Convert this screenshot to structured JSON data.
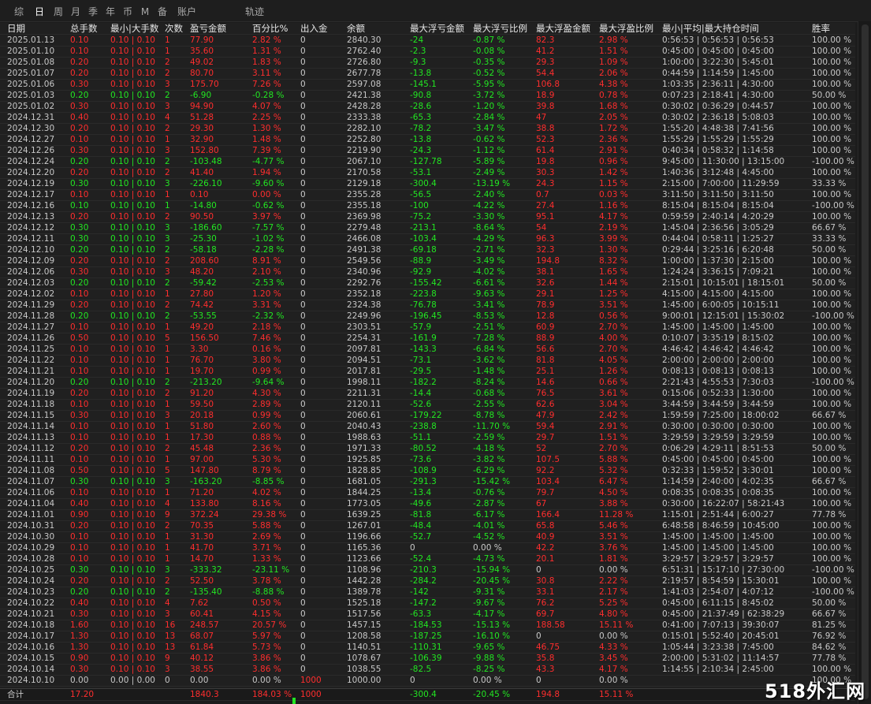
{
  "tabs": [
    "综",
    "日",
    "周",
    "月",
    "季",
    "年",
    "币",
    "M",
    "备",
    "账户",
    "轨迹"
  ],
  "active_tab": 1,
  "headers": [
    "日期",
    "总手数",
    "最小|大手数",
    "次数",
    "盈亏金额",
    "百分比%",
    "出入金",
    "余额",
    "最大浮亏金额",
    "最大浮亏比例",
    "最大浮盈金额",
    "最大浮盈比例",
    "最小|平均|最大持仓时间",
    "胜率"
  ],
  "rows": [
    [
      "2025.01.13",
      "0.10",
      "0.10 | 0.10",
      "1",
      "77.90",
      "2.82 %",
      "0",
      "2840.30",
      "-24",
      "-0.87 %",
      "82.3",
      "2.98 %",
      "0:56:53 | 0:56:53 | 0:56:53",
      "100.00 %"
    ],
    [
      "2025.01.10",
      "0.10",
      "0.10 | 0.10",
      "1",
      "35.60",
      "1.31 %",
      "0",
      "2762.40",
      "-2.3",
      "-0.08 %",
      "41.2",
      "1.51 %",
      "0:45:00 | 0:45:00 | 0:45:00",
      "100.00 %"
    ],
    [
      "2025.01.08",
      "0.20",
      "0.10 | 0.10",
      "2",
      "49.02",
      "1.83 %",
      "0",
      "2726.80",
      "-9.3",
      "-0.35 %",
      "29.3",
      "1.09 %",
      "1:00:00 | 3:22:30 | 5:45:01",
      "100.00 %"
    ],
    [
      "2025.01.07",
      "0.20",
      "0.10 | 0.10",
      "2",
      "80.70",
      "3.11 %",
      "0",
      "2677.78",
      "-13.8",
      "-0.52 %",
      "54.4",
      "2.06 %",
      "0:44:59 | 1:14:59 | 1:45:00",
      "100.00 %"
    ],
    [
      "2025.01.06",
      "0.30",
      "0.10 | 0.10",
      "3",
      "175.70",
      "7.26 %",
      "0",
      "2597.08",
      "-145.1",
      "-5.95 %",
      "106.8",
      "4.38 %",
      "1:03:35 | 2:36:11 | 4:30:00",
      "100.00 %"
    ],
    [
      "2025.01.03",
      "0.20",
      "0.10 | 0.10",
      "2",
      "-6.90",
      "-0.28 %",
      "0",
      "2421.38",
      "-90.8",
      "-3.72 %",
      "18.9",
      "0.78 %",
      "0:07:23 | 2:18:41 | 4:30:00",
      "50.00 %"
    ],
    [
      "2025.01.02",
      "0.30",
      "0.10 | 0.10",
      "3",
      "94.90",
      "4.07 %",
      "0",
      "2428.28",
      "-28.6",
      "-1.20 %",
      "39.8",
      "1.68 %",
      "0:30:02 | 0:36:29 | 0:44:57",
      "100.00 %"
    ],
    [
      "2024.12.31",
      "0.40",
      "0.10 | 0.10",
      "4",
      "51.28",
      "2.25 %",
      "0",
      "2333.38",
      "-65.3",
      "-2.84 %",
      "47",
      "2.05 %",
      "0:30:02 | 2:36:18 | 5:08:03",
      "100.00 %"
    ],
    [
      "2024.12.30",
      "0.20",
      "0.10 | 0.10",
      "2",
      "29.30",
      "1.30 %",
      "0",
      "2282.10",
      "-78.2",
      "-3.47 %",
      "38.8",
      "1.72 %",
      "1:55:20 | 4:48:38 | 7:41:56",
      "100.00 %"
    ],
    [
      "2024.12.27",
      "0.10",
      "0.10 | 0.10",
      "1",
      "32.90",
      "1.48 %",
      "0",
      "2252.80",
      "-13.8",
      "-0.62 %",
      "52.3",
      "2.36 %",
      "1:55:29 | 1:55:29 | 1:55:29",
      "100.00 %"
    ],
    [
      "2024.12.26",
      "0.30",
      "0.10 | 0.10",
      "3",
      "152.80",
      "7.39 %",
      "0",
      "2219.90",
      "-24.3",
      "-1.12 %",
      "61.4",
      "2.91 %",
      "0:40:34 | 0:58:32 | 1:14:58",
      "100.00 %"
    ],
    [
      "2024.12.24",
      "0.20",
      "0.10 | 0.10",
      "2",
      "-103.48",
      "-4.77 %",
      "0",
      "2067.10",
      "-127.78",
      "-5.89 %",
      "19.8",
      "0.96 %",
      "9:45:00 | 11:30:00 | 13:15:00",
      "-100.00 %"
    ],
    [
      "2024.12.20",
      "0.20",
      "0.10 | 0.10",
      "2",
      "41.40",
      "1.94 %",
      "0",
      "2170.58",
      "-53.1",
      "-2.49 %",
      "30.3",
      "1.42 %",
      "1:40:36 | 3:12:48 | 4:45:00",
      "100.00 %"
    ],
    [
      "2024.12.19",
      "0.30",
      "0.10 | 0.10",
      "3",
      "-226.10",
      "-9.60 %",
      "0",
      "2129.18",
      "-300.4",
      "-13.19 %",
      "24.3",
      "1.15 %",
      "2:15:00 | 7:00:00 | 11:29:59",
      "33.33 %"
    ],
    [
      "2024.12.17",
      "0.10",
      "0.10 | 0.10",
      "1",
      "0.10",
      "0.00 %",
      "0",
      "2355.28",
      "-56.5",
      "-2.40 %",
      "0.7",
      "0.03 %",
      "3:11:50 | 3:11:50 | 3:11:50",
      "100.00 %"
    ],
    [
      "2024.12.16",
      "0.10",
      "0.10 | 0.10",
      "1",
      "-14.80",
      "-0.62 %",
      "0",
      "2355.18",
      "-100",
      "-4.22 %",
      "27.4",
      "1.16 %",
      "8:15:04 | 8:15:04 | 8:15:04",
      "-100.00 %"
    ],
    [
      "2024.12.13",
      "0.20",
      "0.10 | 0.10",
      "2",
      "90.50",
      "3.97 %",
      "0",
      "2369.98",
      "-75.2",
      "-3.30 %",
      "95.1",
      "4.17 %",
      "0:59:59 | 2:40:14 | 4:20:29",
      "100.00 %"
    ],
    [
      "2024.12.12",
      "0.30",
      "0.10 | 0.10",
      "3",
      "-186.60",
      "-7.57 %",
      "0",
      "2279.48",
      "-213.1",
      "-8.64 %",
      "54",
      "2.19 %",
      "1:45:04 | 2:36:56 | 3:05:29",
      "66.67 %"
    ],
    [
      "2024.12.11",
      "0.30",
      "0.10 | 0.10",
      "3",
      "-25.30",
      "-1.02 %",
      "0",
      "2466.08",
      "-103.4",
      "-4.29 %",
      "96.3",
      "3.99 %",
      "0:44:04 | 0:58:11 | 1:25:27",
      "33.33 %"
    ],
    [
      "2024.12.10",
      "0.20",
      "0.10 | 0.10",
      "2",
      "-58.18",
      "-2.28 %",
      "0",
      "2491.38",
      "-69.18",
      "-2.71 %",
      "32.3",
      "1.30 %",
      "0:29:44 | 3:25:16 | 6:20:48",
      "50.00 %"
    ],
    [
      "2024.12.09",
      "0.20",
      "0.10 | 0.10",
      "2",
      "208.60",
      "8.91 %",
      "0",
      "2549.56",
      "-88.9",
      "-3.49 %",
      "194.8",
      "8.32 %",
      "1:00:00 | 1:37:30 | 2:15:00",
      "100.00 %"
    ],
    [
      "2024.12.06",
      "0.30",
      "0.10 | 0.10",
      "3",
      "48.20",
      "2.10 %",
      "0",
      "2340.96",
      "-92.9",
      "-4.02 %",
      "38.1",
      "1.65 %",
      "1:24:24 | 3:36:15 | 7:09:21",
      "100.00 %"
    ],
    [
      "2024.12.03",
      "0.20",
      "0.10 | 0.10",
      "2",
      "-59.42",
      "-2.53 %",
      "0",
      "2292.76",
      "-155.42",
      "-6.61 %",
      "32.6",
      "1.44 %",
      "2:15:01 | 10:15:01 | 18:15:01",
      "50.00 %"
    ],
    [
      "2024.12.02",
      "0.10",
      "0.10 | 0.10",
      "1",
      "27.80",
      "1.20 %",
      "0",
      "2352.18",
      "-223.8",
      "-9.63 %",
      "29.1",
      "1.25 %",
      "4:15:00 | 4:15:00 | 4:15:00",
      "100.00 %"
    ],
    [
      "2024.11.29",
      "0.20",
      "0.10 | 0.10",
      "2",
      "74.42",
      "3.31 %",
      "0",
      "2324.38",
      "-76.78",
      "-3.41 %",
      "78.9",
      "3.51 %",
      "1:45:00 | 6:00:05 | 10:15:11",
      "100.00 %"
    ],
    [
      "2024.11.28",
      "0.20",
      "0.10 | 0.10",
      "2",
      "-53.55",
      "-2.32 %",
      "0",
      "2249.96",
      "-196.45",
      "-8.53 %",
      "12.8",
      "0.56 %",
      "9:00:01 | 12:15:01 | 15:30:02",
      "-100.00 %"
    ],
    [
      "2024.11.27",
      "0.10",
      "0.10 | 0.10",
      "1",
      "49.20",
      "2.18 %",
      "0",
      "2303.51",
      "-57.9",
      "-2.51 %",
      "60.9",
      "2.70 %",
      "1:45:00 | 1:45:00 | 1:45:00",
      "100.00 %"
    ],
    [
      "2024.11.26",
      "0.50",
      "0.10 | 0.10",
      "5",
      "156.50",
      "7.46 %",
      "0",
      "2254.31",
      "-161.9",
      "-7.28 %",
      "88.9",
      "4.00 %",
      "0:10:07 | 3:35:19 | 8:15:02",
      "100.00 %"
    ],
    [
      "2024.11.25",
      "0.10",
      "0.10 | 0.10",
      "1",
      "3.30",
      "0.16 %",
      "0",
      "2097.81",
      "-143.3",
      "-6.84 %",
      "56.6",
      "2.70 %",
      "4:46:42 | 4:46:42 | 4:46:42",
      "100.00 %"
    ],
    [
      "2024.11.22",
      "0.10",
      "0.10 | 0.10",
      "1",
      "76.70",
      "3.80 %",
      "0",
      "2094.51",
      "-73.1",
      "-3.62 %",
      "81.8",
      "4.05 %",
      "2:00:00 | 2:00:00 | 2:00:00",
      "100.00 %"
    ],
    [
      "2024.11.21",
      "0.10",
      "0.10 | 0.10",
      "1",
      "19.70",
      "0.99 %",
      "0",
      "2017.81",
      "-29.5",
      "-1.48 %",
      "25.1",
      "1.26 %",
      "0:08:13 | 0:08:13 | 0:08:13",
      "100.00 %"
    ],
    [
      "2024.11.20",
      "0.20",
      "0.10 | 0.10",
      "2",
      "-213.20",
      "-9.64 %",
      "0",
      "1998.11",
      "-182.2",
      "-8.24 %",
      "14.6",
      "0.66 %",
      "2:21:43 | 4:55:53 | 7:30:03",
      "-100.00 %"
    ],
    [
      "2024.11.19",
      "0.20",
      "0.10 | 0.10",
      "2",
      "91.20",
      "4.30 %",
      "0",
      "2211.31",
      "-14.4",
      "-0.68 %",
      "76.5",
      "3.61 %",
      "0:15:06 | 0:52:33 | 1:30:00",
      "100.00 %"
    ],
    [
      "2024.11.18",
      "0.10",
      "0.10 | 0.10",
      "1",
      "59.50",
      "2.89 %",
      "0",
      "2120.11",
      "-52.6",
      "-2.55 %",
      "62.6",
      "3.04 %",
      "3:44:59 | 3:44:59 | 3:44:59",
      "100.00 %"
    ],
    [
      "2024.11.15",
      "0.30",
      "0.10 | 0.10",
      "3",
      "20.18",
      "0.99 %",
      "0",
      "2060.61",
      "-179.22",
      "-8.78 %",
      "47.9",
      "2.42 %",
      "1:59:59 | 7:25:00 | 18:00:02",
      "66.67 %"
    ],
    [
      "2024.11.14",
      "0.10",
      "0.10 | 0.10",
      "1",
      "51.80",
      "2.60 %",
      "0",
      "2040.43",
      "-238.8",
      "-11.70 %",
      "59.4",
      "2.91 %",
      "0:30:00 | 0:30:00 | 0:30:00",
      "100.00 %"
    ],
    [
      "2024.11.13",
      "0.10",
      "0.10 | 0.10",
      "1",
      "17.30",
      "0.88 %",
      "0",
      "1988.63",
      "-51.1",
      "-2.59 %",
      "29.7",
      "1.51 %",
      "3:29:59 | 3:29:59 | 3:29:59",
      "100.00 %"
    ],
    [
      "2024.11.12",
      "0.20",
      "0.10 | 0.10",
      "2",
      "45.48",
      "2.36 %",
      "0",
      "1971.33",
      "-80.52",
      "-4.18 %",
      "52",
      "2.70 %",
      "0:06:29 | 4:29:11 | 8:51:53",
      "50.00 %"
    ],
    [
      "2024.11.11",
      "0.10",
      "0.10 | 0.10",
      "1",
      "97.00",
      "5.30 %",
      "0",
      "1925.85",
      "-73.6",
      "-3.82 %",
      "107.5",
      "5.88 %",
      "0:45:00 | 0:45:00 | 0:45:00",
      "100.00 %"
    ],
    [
      "2024.11.08",
      "0.50",
      "0.10 | 0.10",
      "5",
      "147.80",
      "8.79 %",
      "0",
      "1828.85",
      "-108.9",
      "-6.29 %",
      "92.2",
      "5.32 %",
      "0:32:33 | 1:59:52 | 3:30:01",
      "100.00 %"
    ],
    [
      "2024.11.07",
      "0.30",
      "0.10 | 0.10",
      "3",
      "-163.20",
      "-8.85 %",
      "0",
      "1681.05",
      "-291.3",
      "-15.42 %",
      "103.4",
      "6.47 %",
      "1:14:59 | 2:40:00 | 4:02:35",
      "66.67 %"
    ],
    [
      "2024.11.06",
      "0.10",
      "0.10 | 0.10",
      "1",
      "71.20",
      "4.02 %",
      "0",
      "1844.25",
      "-13.4",
      "-0.76 %",
      "79.7",
      "4.50 %",
      "0:08:35 | 0:08:35 | 0:08:35",
      "100.00 %"
    ],
    [
      "2024.11.04",
      "0.40",
      "0.10 | 0.10",
      "4",
      "133.80",
      "8.16 %",
      "0",
      "1773.05",
      "-49.6",
      "-2.87 %",
      "67",
      "3.88 %",
      "0:30:00 | 16:22:07 | 58:21:43",
      "100.00 %"
    ],
    [
      "2024.11.01",
      "0.90",
      "0.10 | 0.10",
      "9",
      "372.24",
      "29.38 %",
      "0",
      "1639.25",
      "-81.8",
      "-6.17 %",
      "166.4",
      "11.28 %",
      "1:15:01 | 2:51:44 | 6:00:27",
      "77.78 %"
    ],
    [
      "2024.10.31",
      "0.20",
      "0.10 | 0.10",
      "2",
      "70.35",
      "5.88 %",
      "0",
      "1267.01",
      "-48.4",
      "-4.01 %",
      "65.8",
      "5.46 %",
      "6:48:58 | 8:46:59 | 10:45:00",
      "100.00 %"
    ],
    [
      "2024.10.30",
      "0.10",
      "0.10 | 0.10",
      "1",
      "31.30",
      "2.69 %",
      "0",
      "1196.66",
      "-52.7",
      "-4.52 %",
      "40.9",
      "3.51 %",
      "1:45:00 | 1:45:00 | 1:45:00",
      "100.00 %"
    ],
    [
      "2024.10.29",
      "0.10",
      "0.10 | 0.10",
      "1",
      "41.70",
      "3.71 %",
      "0",
      "1165.36",
      "0",
      "0.00 %",
      "42.2",
      "3.76 %",
      "1:45:00 | 1:45:00 | 1:45:00",
      "100.00 %"
    ],
    [
      "2024.10.28",
      "0.10",
      "0.10 | 0.10",
      "1",
      "14.70",
      "1.33 %",
      "0",
      "1123.66",
      "-52.4",
      "-4.73 %",
      "20.1",
      "1.81 %",
      "3:29:57 | 3:29:57 | 3:29:57",
      "100.00 %"
    ],
    [
      "2024.10.25",
      "0.30",
      "0.10 | 0.10",
      "3",
      "-333.32",
      "-23.11 %",
      "0",
      "1108.96",
      "-210.3",
      "-15.94 %",
      "0",
      "0.00 %",
      "6:51:31 | 15:17:10 | 27:30:00",
      "-100.00 %"
    ],
    [
      "2024.10.24",
      "0.20",
      "0.10 | 0.10",
      "2",
      "52.50",
      "3.78 %",
      "0",
      "1442.28",
      "-284.2",
      "-20.45 %",
      "30.8",
      "2.22 %",
      "2:19:57 | 8:54:59 | 15:30:01",
      "100.00 %"
    ],
    [
      "2024.10.23",
      "0.20",
      "0.10 | 0.10",
      "2",
      "-135.40",
      "-8.88 %",
      "0",
      "1389.78",
      "-142",
      "-9.31 %",
      "33.1",
      "2.17 %",
      "1:41:03 | 2:54:07 | 4:07:12",
      "-100.00 %"
    ],
    [
      "2024.10.22",
      "0.40",
      "0.10 | 0.10",
      "4",
      "7.62",
      "0.50 %",
      "0",
      "1525.18",
      "-147.2",
      "-9.67 %",
      "76.2",
      "5.25 %",
      "0:45:00 | 6:11:15 | 8:45:02",
      "50.00 %"
    ],
    [
      "2024.10.21",
      "0.30",
      "0.10 | 0.10",
      "3",
      "60.41",
      "4.15 %",
      "0",
      "1517.56",
      "-63.3",
      "-4.17 %",
      "69.7",
      "4.80 %",
      "0:45:00 | 21:37:49 | 62:38:29",
      "66.67 %"
    ],
    [
      "2024.10.18",
      "1.60",
      "0.10 | 0.10",
      "16",
      "248.57",
      "20.57 %",
      "0",
      "1457.15",
      "-184.53",
      "-15.13 %",
      "188.58",
      "15.11 %",
      "0:41:00 | 7:07:13 | 39:30:07",
      "81.25 %"
    ],
    [
      "2024.10.17",
      "1.30",
      "0.10 | 0.10",
      "13",
      "68.07",
      "5.97 %",
      "0",
      "1208.58",
      "-187.25",
      "-16.10 %",
      "0",
      "0.00 %",
      "0:15:01 | 5:52:40 | 20:45:01",
      "76.92 %"
    ],
    [
      "2024.10.16",
      "1.30",
      "0.10 | 0.10",
      "13",
      "61.84",
      "5.73 %",
      "0",
      "1140.51",
      "-110.31",
      "-9.65 %",
      "46.75",
      "4.33 %",
      "1:05:44 | 3:23:38 | 7:45:00",
      "84.62 %"
    ],
    [
      "2024.10.15",
      "0.90",
      "0.10 | 0.10",
      "9",
      "40.12",
      "3.86 %",
      "0",
      "1078.67",
      "-106.39",
      "-9.88 %",
      "35.8",
      "3.45 %",
      "2:00:00 | 5:31:02 | 11:14:57",
      "77.78 %"
    ],
    [
      "2024.10.14",
      "0.30",
      "0.10 | 0.10",
      "3",
      "38.55",
      "3.86 %",
      "0",
      "1038.55",
      "-82.5",
      "-8.25 %",
      "43.3",
      "4.17 %",
      "1:14:55 | 2:10:34 | 2:45:00",
      "100.00 %"
    ],
    [
      "2024.10.10",
      "0.00",
      "0.00 | 0.00",
      "0",
      "0.00",
      "0.00 %",
      "1000",
      "1000.00",
      "0",
      "0.00 %",
      "0",
      "0.00 %",
      "",
      "100.00 %"
    ]
  ],
  "footer": {
    "label": "合计",
    "total_lots": "17.20",
    "pnl": "1840.3",
    "percent": "184.03 %",
    "deposit": "1000",
    "max_float_loss": "-300.4",
    "max_float_loss_pct": "-20.45 %",
    "max_float_profit": "194.8",
    "max_float_profit_pct": "15.11 %"
  },
  "watermark": "518外汇网",
  "colors": {
    "background": "#1c1c1c",
    "profit": "#ff2e2e",
    "loss": "#22e622",
    "text": "#d0d0d0"
  }
}
